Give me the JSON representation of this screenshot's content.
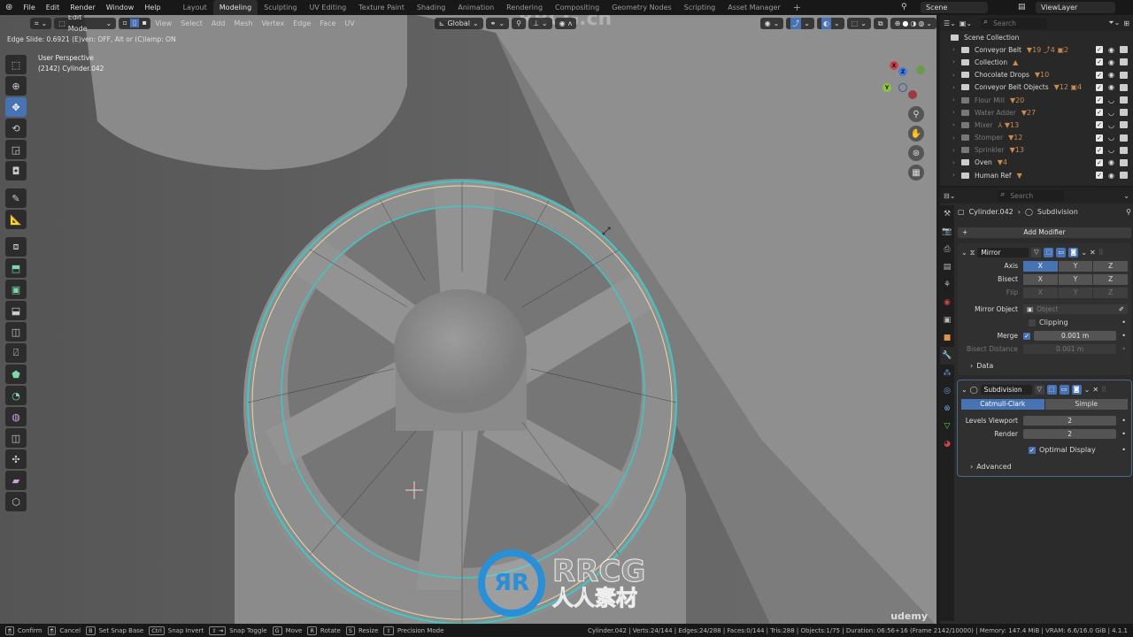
{
  "menu": {
    "items": [
      "File",
      "Edit",
      "Render",
      "Window",
      "Help"
    ]
  },
  "workspaces": [
    {
      "label": "Layout",
      "active": false
    },
    {
      "label": "Modeling",
      "active": true
    },
    {
      "label": "Sculpting",
      "active": false
    },
    {
      "label": "UV Editing",
      "active": false
    },
    {
      "label": "Texture Paint",
      "active": false
    },
    {
      "label": "Shading",
      "active": false
    },
    {
      "label": "Animation",
      "active": false
    },
    {
      "label": "Rendering",
      "active": false
    },
    {
      "label": "Compositing",
      "active": false
    },
    {
      "label": "Geometry Nodes",
      "active": false
    },
    {
      "label": "Scripting",
      "active": false
    },
    {
      "label": "Asset Manager",
      "active": false
    }
  ],
  "add_workspace": "+",
  "scene": {
    "name": "Scene",
    "view_layer": "ViewLayer"
  },
  "viewport": {
    "mode": "Edit Mode",
    "menus": [
      "View",
      "Select",
      "Add",
      "Mesh",
      "Vertex",
      "Edge",
      "Face",
      "UV"
    ],
    "transform_orientation": "Global",
    "operator_status": "Edge Slide: 0.6921 (E)ven: OFF, Alt or (C)lamp: ON",
    "perspective": "User Perspective",
    "object_info": "(2142) Cylinder.042",
    "gizmo_axes": {
      "x": "X",
      "y": "Y",
      "z": "Z"
    }
  },
  "tools": [
    "select-box",
    "cursor",
    "move",
    "rotate",
    "scale",
    "transform",
    "annotate",
    "measure",
    "add-cube",
    "extrude",
    "inset",
    "bevel",
    "loop-cut",
    "knife",
    "poly-build",
    "spin",
    "smooth",
    "edge-slide",
    "shrink-fatten",
    "shear",
    "rip"
  ],
  "outliner": {
    "search_placeholder": "Search",
    "root": "Scene Collection",
    "items": [
      {
        "name": "Conveyor Belt",
        "badges": "▼19 ⤴4 ▣2",
        "visible": true
      },
      {
        "name": "Collection",
        "badges": "▲",
        "visible": true
      },
      {
        "name": "Chocolate Drops",
        "badges": "▼10",
        "visible": true
      },
      {
        "name": "Conveyor Belt Objects",
        "badges": "▼12 ▣4",
        "visible": true
      },
      {
        "name": "Flour Mill",
        "badges": "▼20",
        "visible": false
      },
      {
        "name": "Water Adder",
        "badges": "▼27",
        "visible": false
      },
      {
        "name": "Mixer",
        "badges": "⅄ ▼13",
        "visible": false
      },
      {
        "name": "Stomper",
        "badges": "▼12",
        "visible": false
      },
      {
        "name": "Sprinkler",
        "badges": "▼13",
        "visible": false
      },
      {
        "name": "Oven",
        "badges": "▼4",
        "visible": true
      },
      {
        "name": "Human Ref",
        "badges": "▼",
        "visible": true
      }
    ]
  },
  "properties": {
    "search_placeholder": "Search",
    "breadcrumb": {
      "object": "Cylinder.042",
      "modifier": "Subdivision"
    },
    "add_modifier": "Add Modifier",
    "mirror": {
      "name": "Mirror",
      "axis_label": "Axis",
      "bisect_label": "Bisect",
      "flip_label": "Flip",
      "axes": [
        "X",
        "Y",
        "Z"
      ],
      "axis_active": "X",
      "mirror_object_label": "Mirror Object",
      "mirror_object_placeholder": "Object",
      "clipping_label": "Clipping",
      "clipping": false,
      "merge_label": "Merge",
      "merge": true,
      "merge_value": "0.001 m",
      "bisect_distance_label": "Bisect Distance",
      "bisect_distance": "0.001 m",
      "data_label": "Data"
    },
    "subdivision": {
      "name": "Subdivision",
      "method_options": [
        "Catmull-Clark",
        "Simple"
      ],
      "method_active": "Catmull-Clark",
      "levels_viewport_label": "Levels Viewport",
      "levels_viewport": "2",
      "render_label": "Render",
      "render": "2",
      "optimal_display_label": "Optimal Display",
      "optimal_display": true,
      "advanced_label": "Advanced"
    }
  },
  "statusbar": {
    "hints": [
      {
        "key": "🖱",
        "label": "Confirm"
      },
      {
        "key": "🖱",
        "label": "Cancel"
      },
      {
        "key": "B",
        "label": "Set Snap Base"
      },
      {
        "key": "Ctrl",
        "label": "Snap Invert"
      },
      {
        "key": "⇧ ⇥",
        "label": "Snap Toggle"
      },
      {
        "key": "G",
        "label": "Move"
      },
      {
        "key": "R",
        "label": "Rotate"
      },
      {
        "key": "S",
        "label": "Resize"
      },
      {
        "key": "⇧",
        "label": "Precision Mode"
      }
    ],
    "stats": "Cylinder.042 | Verts:24/144 | Edges:24/288 | Faces:0/144 | Tris:288 | Objects:1/75 | Duration: 06:56+16 (Frame 2142/10000) | Memory: 147.4 MiB | VRAM: 6.6/16.0 GiB | 4.1.1"
  },
  "watermark": {
    "top": "RRCG.cn",
    "logo_text": "RRCG",
    "logo_sub": "人人素材",
    "corner": "udemy"
  },
  "colors": {
    "accent": "#4772b3",
    "selection": "#3fc7c7",
    "edge": "#e8d9a8"
  }
}
